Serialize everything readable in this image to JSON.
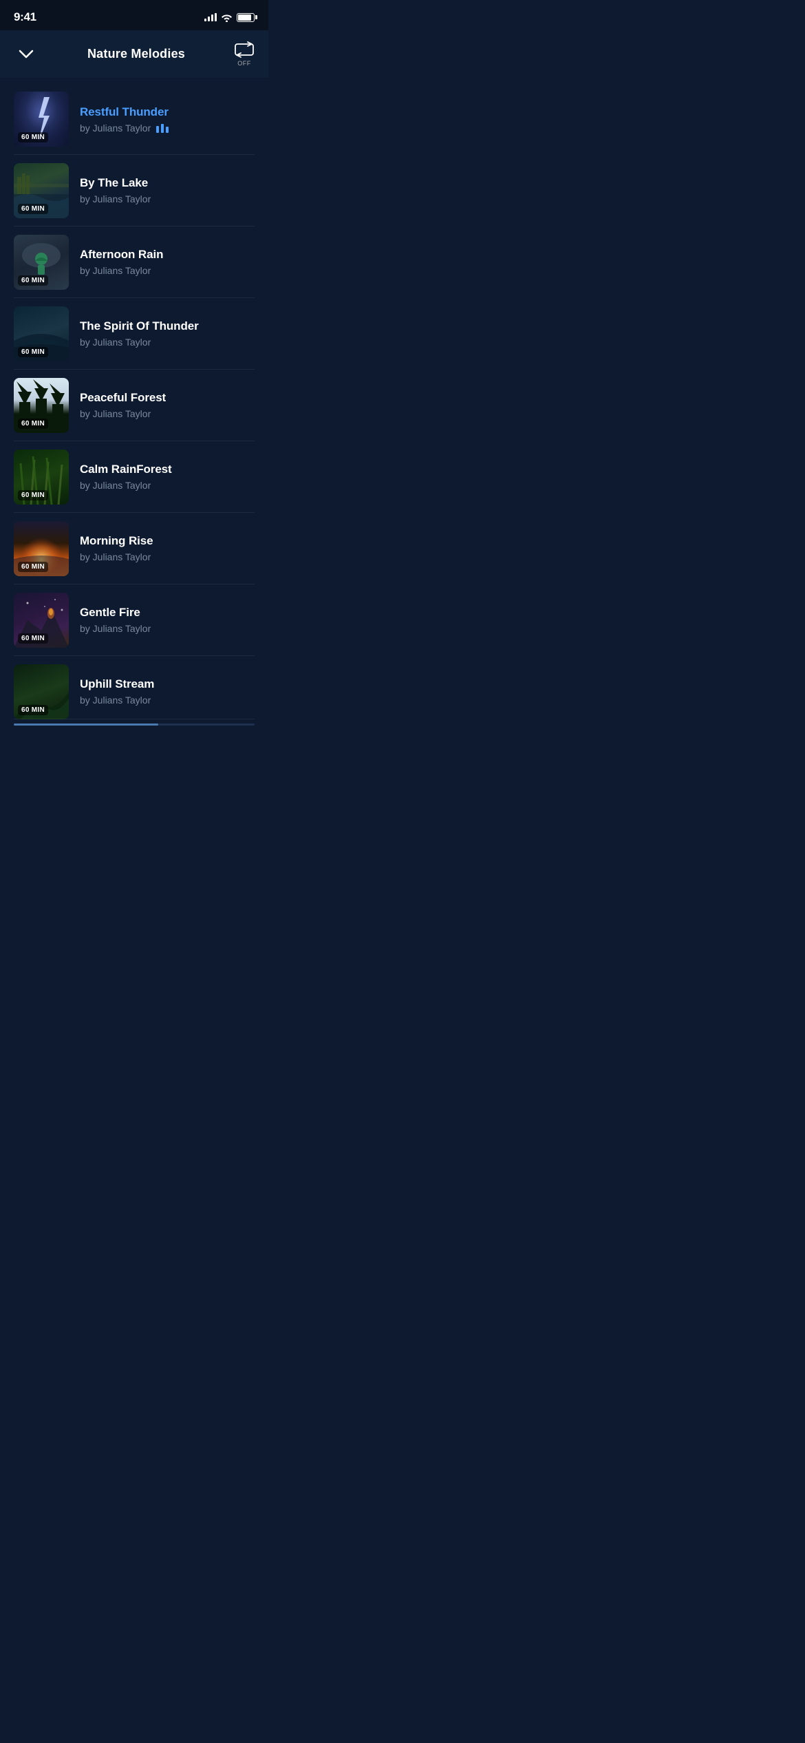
{
  "statusBar": {
    "time": "9:41"
  },
  "header": {
    "title": "Nature Melodies",
    "chevronLabel": "chevron down",
    "repeatLabel": "OFF"
  },
  "tracks": [
    {
      "id": "restful-thunder",
      "title": "Restful Thunder",
      "artist": "by Julians Taylor",
      "duration": "60 MIN",
      "isActive": true,
      "thumbClass": "lightning-bg"
    },
    {
      "id": "by-the-lake",
      "title": "By The Lake",
      "artist": "by Julians Taylor",
      "duration": "60 MIN",
      "isActive": false,
      "thumbClass": "thumb-lake"
    },
    {
      "id": "afternoon-rain",
      "title": "Afternoon Rain",
      "artist": "by Julians Taylor",
      "duration": "60 MIN",
      "isActive": false,
      "thumbClass": "thumb-rain"
    },
    {
      "id": "spirit-of-thunder",
      "title": "The Spirit Of Thunder",
      "artist": "by Julians Taylor",
      "duration": "60 MIN",
      "isActive": false,
      "thumbClass": "thumb-spirit"
    },
    {
      "id": "peaceful-forest",
      "title": "Peaceful Forest",
      "artist": "by Julians Taylor",
      "duration": "60 MIN",
      "isActive": false,
      "thumbClass": "thumb-forest"
    },
    {
      "id": "calm-rainforest",
      "title": "Calm RainForest",
      "artist": "by Julians Taylor",
      "duration": "60 MIN",
      "isActive": false,
      "thumbClass": "thumb-rainforest"
    },
    {
      "id": "morning-rise",
      "title": "Morning Rise",
      "artist": "by Julians Taylor",
      "duration": "60 MIN",
      "isActive": false,
      "thumbClass": "thumb-morning"
    },
    {
      "id": "gentle-fire",
      "title": "Gentle Fire",
      "artist": "by Julians Taylor",
      "duration": "60 MIN",
      "isActive": false,
      "thumbClass": "thumb-fire"
    },
    {
      "id": "uphill-stream",
      "title": "Uphill Stream",
      "artist": "by Julians Taylor",
      "duration": "60 MIN",
      "isActive": false,
      "thumbClass": "thumb-uphill",
      "partial": true
    }
  ]
}
